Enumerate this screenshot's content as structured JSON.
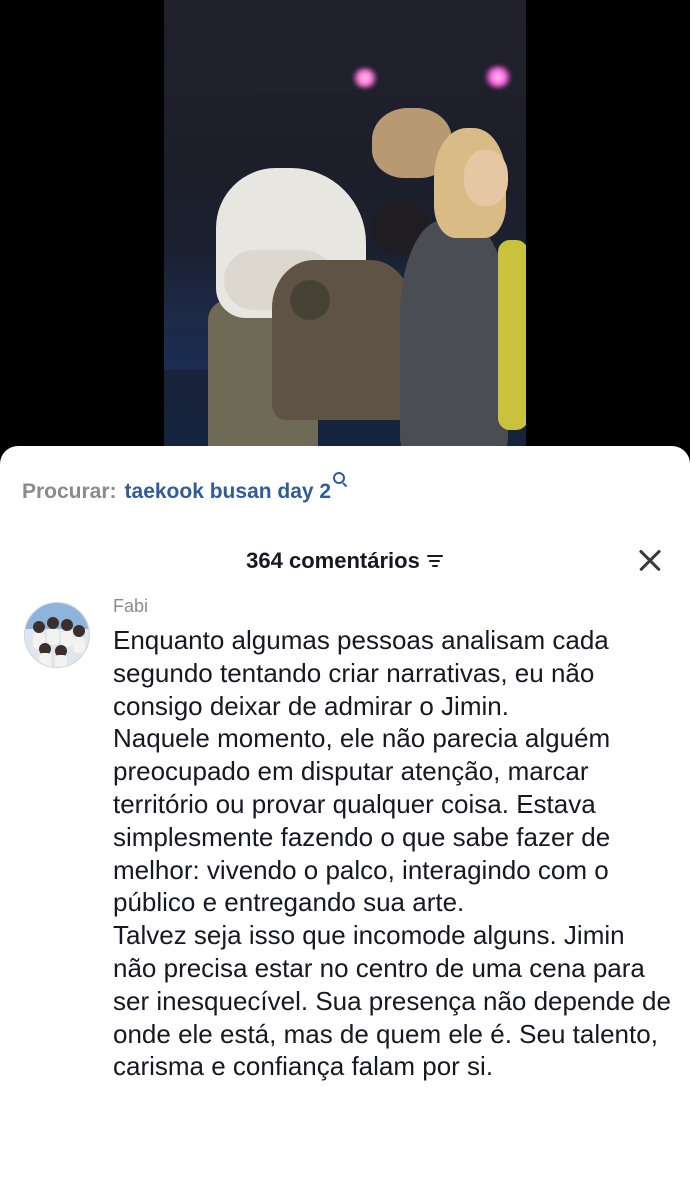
{
  "search": {
    "label": "Procurar:",
    "term": "taekook busan day 2",
    "icon": "search-icon"
  },
  "comments_header": {
    "count_label": "364 comentários",
    "sort_icon": "sort-icon",
    "close_icon": "close-icon"
  },
  "comment": {
    "username": "Fabi",
    "paragraphs": [
      "Enquanto algumas pessoas analisam cada segundo tentando criar narrativas, eu não consigo deixar de admirar o Jimin.",
      "Naquele momento, ele não parecia alguém preocupado em disputar atenção, marcar território ou provar qualquer coisa. Estava simplesmente fazendo o que sabe fazer de melhor: vivendo o palco, interagindo com o público e entregando sua arte.",
      "Talvez seja isso que incomode alguns. Jimin não precisa estar no centro de uma cena para ser inesquecível. Sua presença não depende de onde ele está, mas de quem ele é. Seu talento, carisma e confiança falam por si."
    ]
  },
  "colors": {
    "search_term": "#2f5d9b",
    "text_primary": "#161823",
    "text_secondary": "#8a8b91",
    "sheet_background": "#ffffff"
  }
}
